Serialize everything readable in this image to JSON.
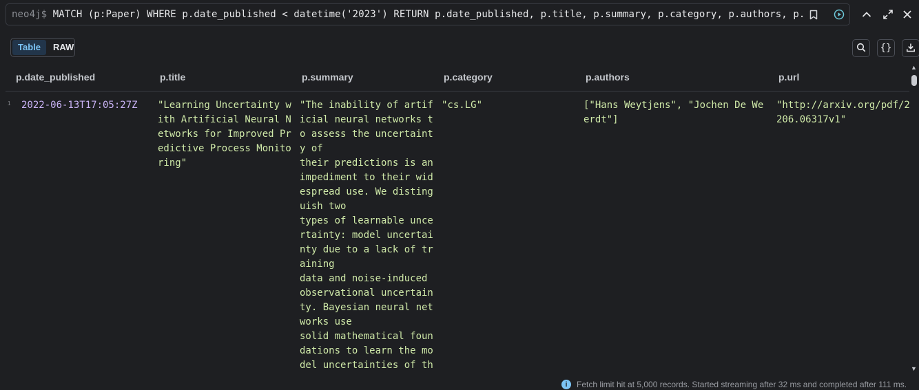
{
  "query": {
    "prompt": "neo4j$",
    "text": "MATCH (p:Paper) WHERE p.date_published < datetime('2023') RETURN p.date_published, p.title, p.summary, p.category, p.authors, p.url"
  },
  "view_toggle": {
    "table_label": "Table",
    "raw_label": "RAW",
    "active": "Table"
  },
  "toolbar": {
    "search_icon": "search-icon",
    "json_icon": "{}",
    "download_icon": "download-icon"
  },
  "table": {
    "columns": [
      "p.date_published",
      "p.title",
      "p.summary",
      "p.category",
      "p.authors",
      "p.url"
    ],
    "rows": [
      {
        "index": "1",
        "date_published": "2022-06-13T17:05:27Z",
        "title": "\"Learning Uncertainty w\nith Artificial Neural N\networks for Improved Pr\nedictive Process Monito\nring\"",
        "summary": "\"The inability of artif\nicial neural networks t\no assess the uncertaint\ny of\ntheir predictions is an\nimpediment to their wid\nespread use. We disting\nuish two\ntypes of learnable unce\nrtainty: model uncertai\nnty due to a lack of tr\naining\ndata and noise-induced\nobservational uncertain\nty. Bayesian neural net\nworks use\nsolid mathematical foun\ndations to learn the mo\ndel uncertainties of th\ne",
        "category": "\"cs.LG\"",
        "authors": "[\"Hans Weytjens\", \"Jochen De We\nerdt\"]",
        "url": "\"http://arxiv.org/pdf/2\n206.06317v1\""
      }
    ]
  },
  "status": {
    "text": "Fetch limit hit at 5,000 records. Started streaming after 32 ms and completed after 111 ms."
  },
  "colors": {
    "background": "#1e1f22",
    "string": "#cfe9a8",
    "date": "#c9b3f5",
    "accent": "#7cc4f5"
  }
}
